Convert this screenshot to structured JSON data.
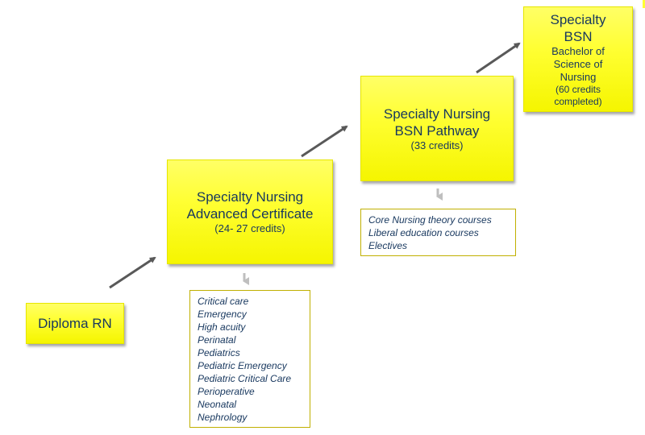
{
  "diagram": {
    "nodes": {
      "diploma": {
        "title": "Diploma RN"
      },
      "certificate": {
        "title_lines": [
          "Specialty Nursing",
          "Advanced Certificate"
        ],
        "credits": "(24- 27 credits)"
      },
      "pathway": {
        "title_lines": [
          "Specialty Nursing",
          "BSN Pathway"
        ],
        "credits": "(33 credits)"
      },
      "bsn": {
        "title_lines": [
          "Specialty",
          "BSN"
        ],
        "desc_lines": [
          "Bachelor of",
          "Science of",
          "Nursing"
        ],
        "credits_lines": [
          "(60 credits",
          "completed)"
        ]
      }
    },
    "certificate_specialties": [
      "Critical care",
      "Emergency",
      "High acuity",
      "Perinatal",
      "Pediatrics",
      "Pediatric Emergency",
      "Pediatric Critical Care",
      "Perioperative",
      "Neonatal",
      "Nephrology"
    ],
    "pathway_courses": [
      "Core Nursing theory courses",
      "Liberal education courses",
      "Electives"
    ],
    "edges": [
      {
        "from": "diploma",
        "to": "certificate"
      },
      {
        "from": "certificate",
        "to": "pathway"
      },
      {
        "from": "pathway",
        "to": "bsn"
      },
      {
        "from": "certificate",
        "to": "certificate_specialties"
      },
      {
        "from": "pathway",
        "to": "pathway_courses"
      }
    ],
    "colors": {
      "box_fill": "#ffff33",
      "text": "#17375e",
      "arrow": "#595959",
      "list_border": "#c0b000"
    }
  }
}
